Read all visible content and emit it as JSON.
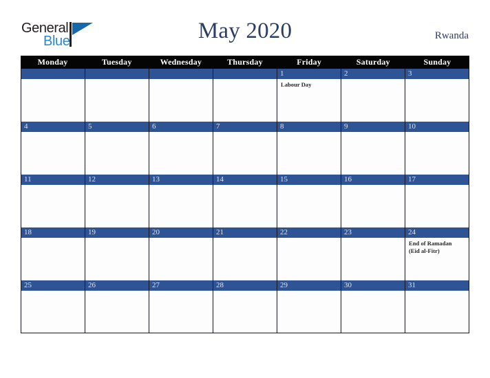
{
  "logo": {
    "text_top": "General",
    "text_bottom": "Blue",
    "triangle_color": "#1769ab",
    "bottom_color": "#2c87c8",
    "top_color": "#231f20"
  },
  "header": {
    "title": "May 2020",
    "country": "Rwanda",
    "title_color": "#2c3e63"
  },
  "calendar": {
    "header_background": "#050505",
    "day_band_color": "#2f5496",
    "weekdays": [
      "Monday",
      "Tuesday",
      "Wednesday",
      "Thursday",
      "Friday",
      "Saturday",
      "Sunday"
    ],
    "weeks": [
      [
        {
          "day": "",
          "events": []
        },
        {
          "day": "",
          "events": []
        },
        {
          "day": "",
          "events": []
        },
        {
          "day": "",
          "events": []
        },
        {
          "day": "1",
          "events": [
            "Labour Day"
          ]
        },
        {
          "day": "2",
          "events": []
        },
        {
          "day": "3",
          "events": []
        }
      ],
      [
        {
          "day": "4",
          "events": []
        },
        {
          "day": "5",
          "events": []
        },
        {
          "day": "6",
          "events": []
        },
        {
          "day": "7",
          "events": []
        },
        {
          "day": "8",
          "events": []
        },
        {
          "day": "9",
          "events": []
        },
        {
          "day": "10",
          "events": []
        }
      ],
      [
        {
          "day": "11",
          "events": []
        },
        {
          "day": "12",
          "events": []
        },
        {
          "day": "13",
          "events": []
        },
        {
          "day": "14",
          "events": []
        },
        {
          "day": "15",
          "events": []
        },
        {
          "day": "16",
          "events": []
        },
        {
          "day": "17",
          "events": []
        }
      ],
      [
        {
          "day": "18",
          "events": []
        },
        {
          "day": "19",
          "events": []
        },
        {
          "day": "20",
          "events": []
        },
        {
          "day": "21",
          "events": []
        },
        {
          "day": "22",
          "events": []
        },
        {
          "day": "23",
          "events": []
        },
        {
          "day": "24",
          "events": [
            "End of Ramadan",
            "(Eid al-Fitr)"
          ]
        }
      ],
      [
        {
          "day": "25",
          "events": []
        },
        {
          "day": "26",
          "events": []
        },
        {
          "day": "27",
          "events": []
        },
        {
          "day": "28",
          "events": []
        },
        {
          "day": "29",
          "events": []
        },
        {
          "day": "30",
          "events": []
        },
        {
          "day": "31",
          "events": []
        }
      ]
    ]
  }
}
